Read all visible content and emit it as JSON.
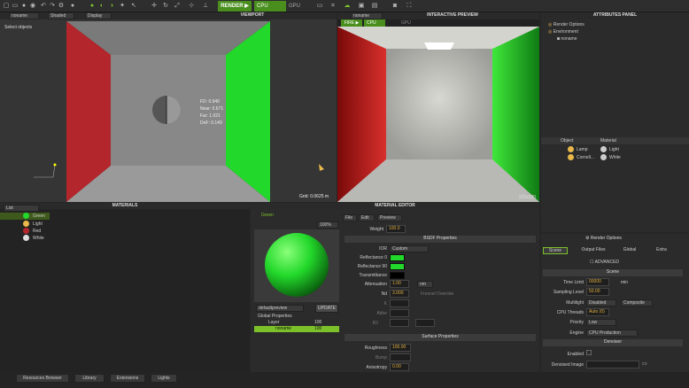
{
  "toolbar": {
    "view_select": "noname",
    "shading": "Shaded",
    "display": "Display",
    "render": "RENDER",
    "cpu": "CPU",
    "gpu": "GPU"
  },
  "viewport": {
    "title": "VIEWPORT",
    "mode": "Select objects",
    "stats": [
      "FD: 0.940",
      "Near: 0.671",
      "Far: 1.021",
      "DoF: 0.149"
    ],
    "grid": "Grid: 0.0625 m"
  },
  "preview": {
    "view": "noname",
    "title": "INTERACTIVE PREVIEW",
    "fire": "FIRE",
    "cpu": "CPU",
    "gpu": "GPU",
    "size": "320x320"
  },
  "attributes": {
    "title": "ATTRIBUTES PANEL",
    "tree": [
      "Render Options",
      "Environment",
      "noname"
    ],
    "table_headers": [
      "Object",
      "Material"
    ],
    "rows": [
      {
        "obj": "Lamp",
        "mat": "Light"
      },
      {
        "obj": "Cornell...",
        "mat": "White"
      }
    ]
  },
  "materials": {
    "title": "MATERIALS",
    "filter": "List",
    "items": [
      "Green",
      "Light",
      "Red",
      "White"
    ]
  },
  "editor": {
    "title": "MATERIAL EDITOR",
    "mat_name": "Green",
    "zoom": "100%",
    "preview_mode": "defaultpreview",
    "update": "UPDATE",
    "menus": [
      "File",
      "Edit",
      "Preview"
    ],
    "weight_label": "Weight",
    "weight": "100.0",
    "bsdf": "BSDF Properties",
    "ior_label": "IOR",
    "ior": "Custom",
    "refl0": "Reflectance 0",
    "refl90": "Reflectance 90",
    "trans": "Transmittance",
    "att_label": "Attenuation",
    "att": "1.00",
    "att_unit": "nm",
    "nd_label": "Nd",
    "nd": "3.000",
    "k_label": "K",
    "abbe_label": "Abbe",
    "r2_label": "R2",
    "fresnel": "Fresnel Override",
    "surface": "Surface Properties",
    "rough_label": "Roughness",
    "rough": "100.00",
    "bump_label": "Bump",
    "aniso_label": "Anisotropy",
    "aniso": "0.00",
    "global_props": "Global Properties",
    "layer": "Layer",
    "layer_val": "100",
    "noname": "noname",
    "noname_val": "100"
  },
  "render_opts": {
    "title": "Render Options",
    "tabs": [
      "Scene",
      "Output Files",
      "Global",
      "Extra"
    ],
    "advanced": "ADVANCED",
    "scene": "Scene",
    "time_label": "Time Limit",
    "time": "00000",
    "time_unit": "min",
    "sl_label": "Sampling Level",
    "sl": "50.00",
    "mlt_label": "Multilight",
    "mlt": "Disabled",
    "mlt2": "Composite",
    "threads_label": "CPU Threads",
    "threads": "Auto (0)",
    "prio_label": "Priority",
    "prio": "Low",
    "engine_label": "Engine",
    "engine": "CPU Production",
    "denoiser": "Denoiser",
    "enabled": "Enabled",
    "denoised_image": "Denoised Image"
  },
  "bottom_tabs": [
    "Resources Browser",
    "Library",
    "Extensions",
    "Lights"
  ],
  "colors": {
    "accent": "#7dc12a",
    "green_wall": "#22d82a",
    "red_wall": "#b3262c"
  }
}
